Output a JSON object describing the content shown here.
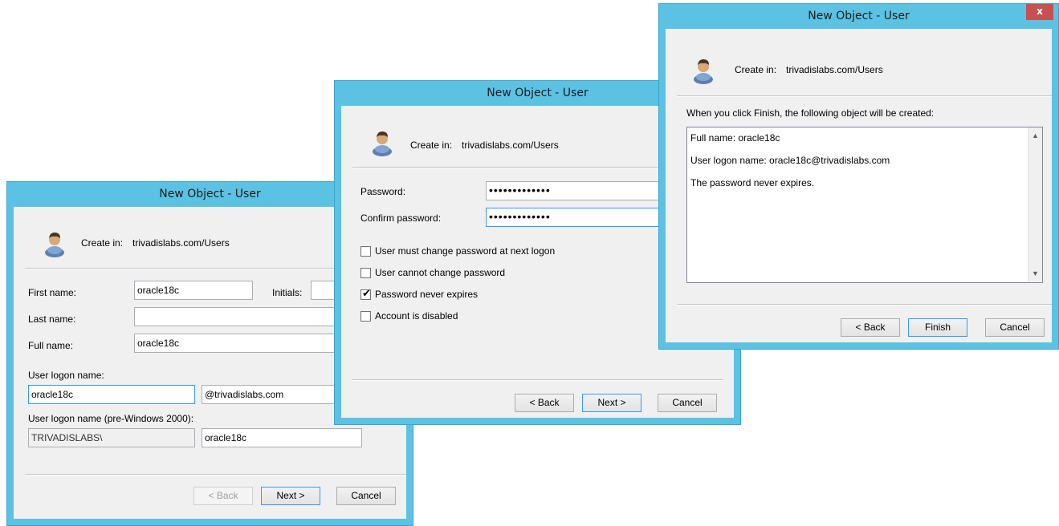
{
  "dialog1": {
    "title": "New Object - User",
    "create_in_label": "Create in:",
    "create_in_value": "trivadislabs.com/Users",
    "first_name_label": "First name:",
    "first_name_value": "oracle18c",
    "initials_label": "Initials:",
    "initials_value": "",
    "last_name_label": "Last name:",
    "last_name_value": "",
    "full_name_label": "Full name:",
    "full_name_value": "oracle18c",
    "logon_label": "User logon name:",
    "logon_value": "oracle18c",
    "domain_value": "@trivadislabs.com",
    "pre2000_label": "User logon name (pre-Windows 2000):",
    "pre2000_domain": "TRIVADISLABS\\",
    "pre2000_value": "oracle18c",
    "back_label": "< Back",
    "next_label": "Next >",
    "cancel_label": "Cancel"
  },
  "dialog2": {
    "title": "New Object - User",
    "create_in_label": "Create in:",
    "create_in_value": "trivadislabs.com/Users",
    "password_label": "Password:",
    "password_mask": "•••••••••••••",
    "confirm_label": "Confirm password:",
    "confirm_mask": "•••••••••••••",
    "options": [
      {
        "label": "User must change password at next logon",
        "checked": false
      },
      {
        "label": "User cannot change password",
        "checked": false
      },
      {
        "label": "Password never expires",
        "checked": true
      },
      {
        "label": "Account is disabled",
        "checked": false
      }
    ],
    "back_label": "< Back",
    "next_label": "Next >",
    "cancel_label": "Cancel"
  },
  "dialog3": {
    "title": "New Object - User",
    "close_glyph": "x",
    "create_in_label": "Create in:",
    "create_in_value": "trivadislabs.com/Users",
    "intro": "When you click Finish, the following object will be created:",
    "summary": [
      "Full name: oracle18c",
      "User logon name: oracle18c@trivadislabs.com",
      "The password never expires."
    ],
    "back_label": "< Back",
    "finish_label": "Finish",
    "cancel_label": "Cancel"
  },
  "colors": {
    "frame": "#5cc2e3",
    "client": "#f0f0f0",
    "close": "#c75050",
    "focus": "#3399ff"
  },
  "icons": [
    "user-icon",
    "checkmark-icon",
    "close-icon",
    "scroll-up-icon",
    "scroll-down-icon"
  ]
}
